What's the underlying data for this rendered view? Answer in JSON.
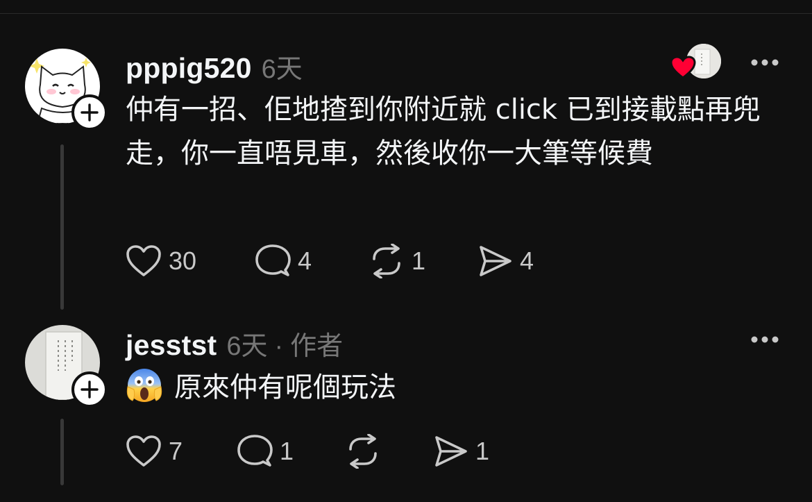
{
  "comments": [
    {
      "username": "pppig520",
      "time": "6天",
      "text": "仲有一招、佢地揸到你附近就 click 已到接載點再兜走，你一直唔見車，然後收你一大筆等候費",
      "likes": "30",
      "replies": "4",
      "reposts": "1",
      "shares": "4",
      "avatar_icon": "cat-avatar",
      "author_liked": true
    },
    {
      "username": "jesstst",
      "time": "6天",
      "separator": "·",
      "author_tag": "作者",
      "emoji": "screaming-face-emoji",
      "text": "原來仲有呢個玩法",
      "likes": "7",
      "replies": "1",
      "reposts": "",
      "shares": "1"
    }
  ],
  "colors": {
    "background": "#101010",
    "text": "#f3f5f7",
    "muted": "#777777",
    "thread_line": "#383838",
    "heart": "#ff0034"
  }
}
